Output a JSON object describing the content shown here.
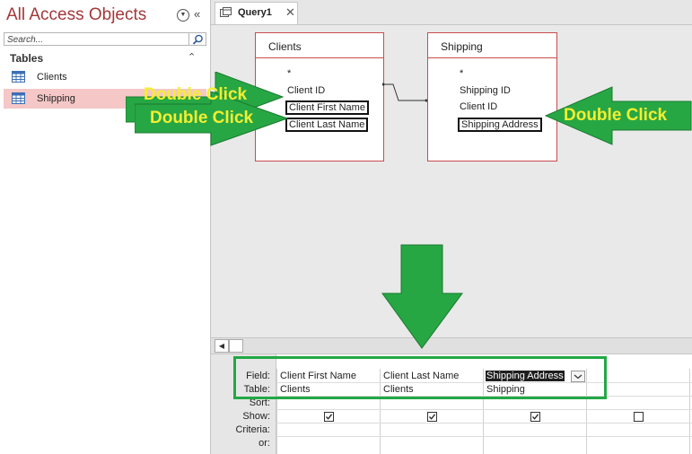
{
  "nav": {
    "title": "All Access Objects",
    "search_placeholder": "Search...",
    "section_header": "Tables",
    "items": [
      {
        "label": "Clients",
        "icon": "table-icon"
      },
      {
        "label": "Shipping",
        "icon": "table-icon",
        "selected": true
      }
    ]
  },
  "tab": {
    "label": "Query1",
    "close": "✕"
  },
  "field_lists": {
    "clients": {
      "title": "Clients",
      "fields": [
        "*",
        "Client ID",
        "Client First Name",
        "Client Last Name"
      ]
    },
    "shipping": {
      "title": "Shipping",
      "fields": [
        "*",
        "Shipping ID",
        "Client ID",
        "Shipping Address"
      ]
    }
  },
  "annotations": {
    "left_callout_1": "Double Click",
    "left_callout_2": "Double Click",
    "right_callout": "Double Click",
    "arrow_color": "#27a744",
    "callout_color": "#f5ee30"
  },
  "grid": {
    "row_labels": [
      "Field:",
      "Table:",
      "Sort:",
      "Show:",
      "Criteria:",
      "or:"
    ],
    "columns": [
      {
        "field": "Client First Name",
        "table": "Clients",
        "show": true
      },
      {
        "field": "Client Last Name",
        "table": "Clients",
        "show": true
      },
      {
        "field": "Shipping Address",
        "table": "Shipping",
        "show": true
      },
      {
        "field": "",
        "table": "",
        "show": false
      }
    ]
  }
}
